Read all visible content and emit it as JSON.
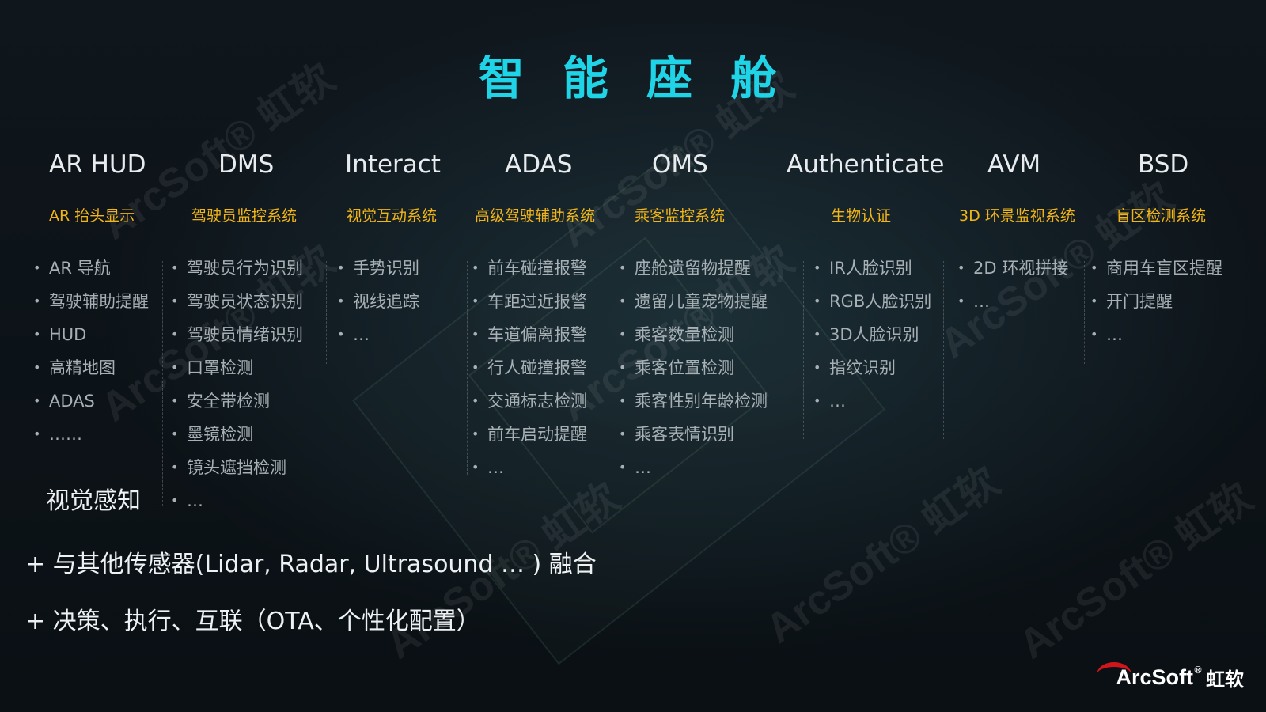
{
  "title": "智 能 座 舱",
  "watermark": "ArcSoft® 虹软",
  "columns": [
    {
      "head": "AR HUD",
      "sub": "AR 抬头显示",
      "items": [
        "AR 导航",
        "驾驶辅助提醒",
        "HUD",
        "高精地图",
        "ADAS",
        "……"
      ]
    },
    {
      "head": "DMS",
      "sub": "驾驶员监控系统",
      "items": [
        "驾驶员行为识别",
        "驾驶员状态识别",
        "驾驶员情绪识别",
        "口罩检测",
        "安全带检测",
        "墨镜检测",
        "镜头遮挡检测",
        "…"
      ]
    },
    {
      "head": "Interact",
      "sub": "视觉互动系统",
      "items": [
        "手势识别",
        "视线追踪",
        "…"
      ]
    },
    {
      "head": "ADAS",
      "sub": "高级驾驶辅助系统",
      "items": [
        "前车碰撞报警",
        "车距过近报警",
        "车道偏离报警",
        "行人碰撞报警",
        "交通标志检测",
        "前车启动提醒",
        "…"
      ]
    },
    {
      "head": "OMS",
      "sub": "乘客监控系统",
      "items": [
        "座舱遗留物提醒",
        "遗留儿童宠物提醒",
        "乘客数量检测",
        "乘客位置检测",
        "乘客性别年龄检测",
        "乘客表情识别",
        "…"
      ]
    },
    {
      "head": "Authenticate",
      "sub": "生物认证",
      "items": [
        "IR人脸识别",
        "RGB人脸识别",
        "3D人脸识别",
        "指纹识别",
        "…"
      ]
    },
    {
      "head": "AVM",
      "sub": "3D 环景监视系统",
      "items": [
        "2D 环视拼接",
        "…"
      ]
    },
    {
      "head": "BSD",
      "sub": "盲区检测系统",
      "items": [
        "商用车盲区提醒",
        "开门提醒",
        "…"
      ]
    }
  ],
  "perception_label": "视觉感知",
  "bottom_lines": [
    "+ 与其他传感器(Lidar, Radar, Ultrasound … ) 融合",
    "+ 决策、执行、互联（OTA、个性化配置）"
  ],
  "logo": {
    "text": "ArcSoft",
    "reg": "®",
    "cn": "虹软",
    "accent": "#d0161c"
  },
  "colors": {
    "title": "#1fd4e6",
    "subtitle": "#f2b516"
  }
}
